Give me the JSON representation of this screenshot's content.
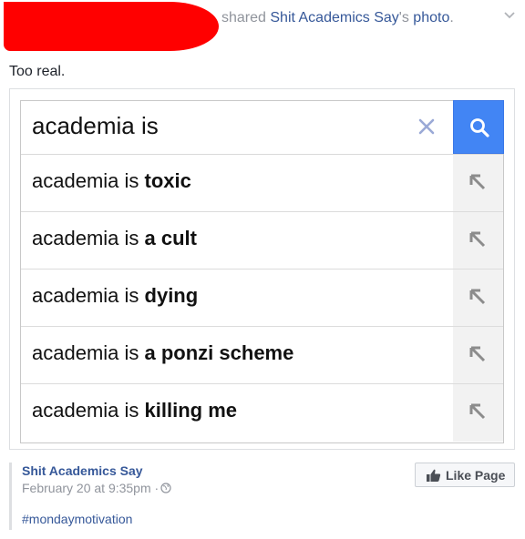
{
  "post": {
    "header_action": "shared",
    "shared_page": "Shit Academics Say",
    "possessive": "'s",
    "shared_object": "photo",
    "period": ".",
    "caption": "Too real."
  },
  "search": {
    "query": "academia is",
    "suggestions": [
      {
        "prefix": "academia is ",
        "completion": "toxic"
      },
      {
        "prefix": "academia is ",
        "completion": "a cult"
      },
      {
        "prefix": "academia is ",
        "completion": "dying"
      },
      {
        "prefix": "academia is ",
        "completion": "a ponzi scheme"
      },
      {
        "prefix": "academia is ",
        "completion": "killing me"
      }
    ]
  },
  "page_card": {
    "page_name": "Shit Academics Say",
    "date": "February 20 at 9:35pm · ",
    "hashtag": "#mondaymotivation",
    "like_label": "Like Page"
  },
  "colors": {
    "link": "#365899",
    "search_button": "#4285f4",
    "redaction": "#ff0000"
  },
  "icons": [
    "chevron-down-icon",
    "clear-x-icon",
    "search-icon",
    "arrow-up-left-icon",
    "globe-icon",
    "thumbs-up-icon"
  ]
}
